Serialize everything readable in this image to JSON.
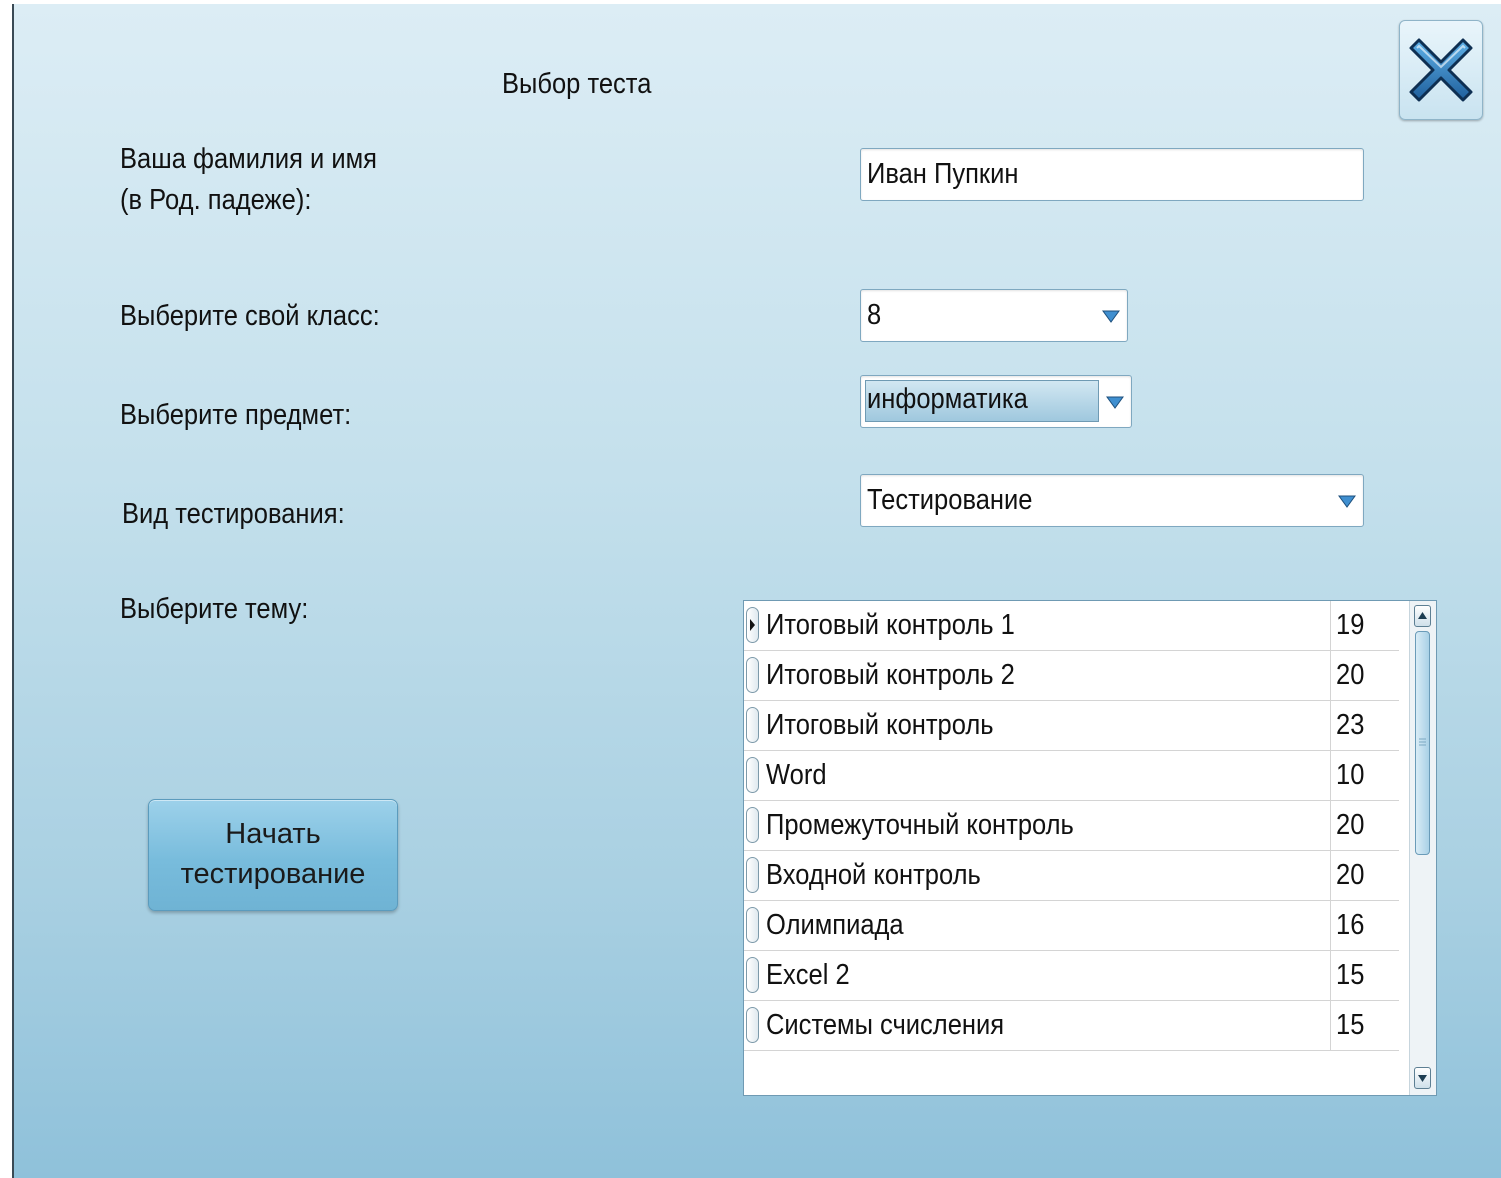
{
  "window": {
    "title": "Выбор теста"
  },
  "form": {
    "name_label_line1": "Ваша фамилия и имя",
    "name_label_line2": "(в Род. падеже):",
    "name_value": "Иван Пупкин",
    "class_label": "Выберите свой класс:",
    "class_value": "8",
    "subject_label": "Выберите предмет:",
    "subject_value": "информатика",
    "test_type_label": "Вид тестирования:",
    "test_type_value": "Тестирование",
    "topic_label": "Выберите тему:"
  },
  "start_button": {
    "line1": "Начать",
    "line2": "тестирование"
  },
  "topics": [
    {
      "name": "Итоговый контроль 1",
      "count": "19"
    },
    {
      "name": "Итоговый контроль 2",
      "count": "20"
    },
    {
      "name": "Итоговый контроль",
      "count": "23"
    },
    {
      "name": "Word",
      "count": "10"
    },
    {
      "name": "Промежуточный контроль",
      "count": "20"
    },
    {
      "name": "Входной контроль",
      "count": "20"
    },
    {
      "name": "Олимпиада",
      "count": "16"
    },
    {
      "name": "Excel 2",
      "count": "15"
    },
    {
      "name": "Системы счисления",
      "count": "15"
    }
  ],
  "icons": {
    "close": "close-x-icon",
    "dropdown": "chevron-down-icon",
    "row_indicator": "row-selector-icon"
  },
  "colors": {
    "background_top": "#dcedf5",
    "background_bottom": "#8fc1da",
    "close_x_fill": "#2f7fc0",
    "button": "#78bcdc"
  }
}
